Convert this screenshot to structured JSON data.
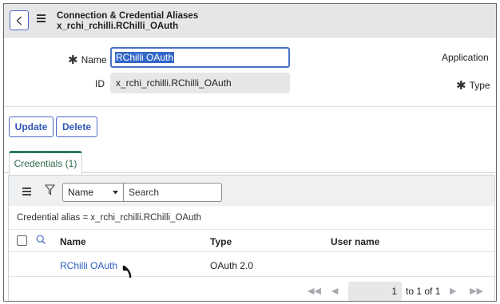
{
  "header": {
    "title_line1": "Connection & Credential Aliases",
    "title_line2": "x_rchi_rchilli.RChilli_OAuth"
  },
  "form": {
    "name_label": "Name",
    "name_value": "RChilli OAuth",
    "id_label": "ID",
    "id_value": "x_rchi_rchilli.RChilli_OAuth",
    "application_label": "Application",
    "type_label": "Type"
  },
  "actions": {
    "update_label": "Update",
    "delete_label": "Delete"
  },
  "tabs": [
    {
      "label": "Credentials (1)",
      "active": true
    }
  ],
  "related_list": {
    "select_value": "Name",
    "search_placeholder": "Search",
    "breadcrumb": "Credential alias = x_rchi_rchilli.RChilli_OAuth",
    "columns": [
      "Name",
      "Type",
      "User name"
    ],
    "rows": [
      {
        "name": "RChilli OAuth",
        "type": "OAuth 2.0",
        "user_name": ""
      }
    ],
    "pager": {
      "current_page": "1",
      "range_text": "to 1 of 1"
    }
  },
  "colors": {
    "accent_blue": "#3156b8",
    "tab_green": "#2b7a5a",
    "link_blue": "#2f5fbf"
  }
}
